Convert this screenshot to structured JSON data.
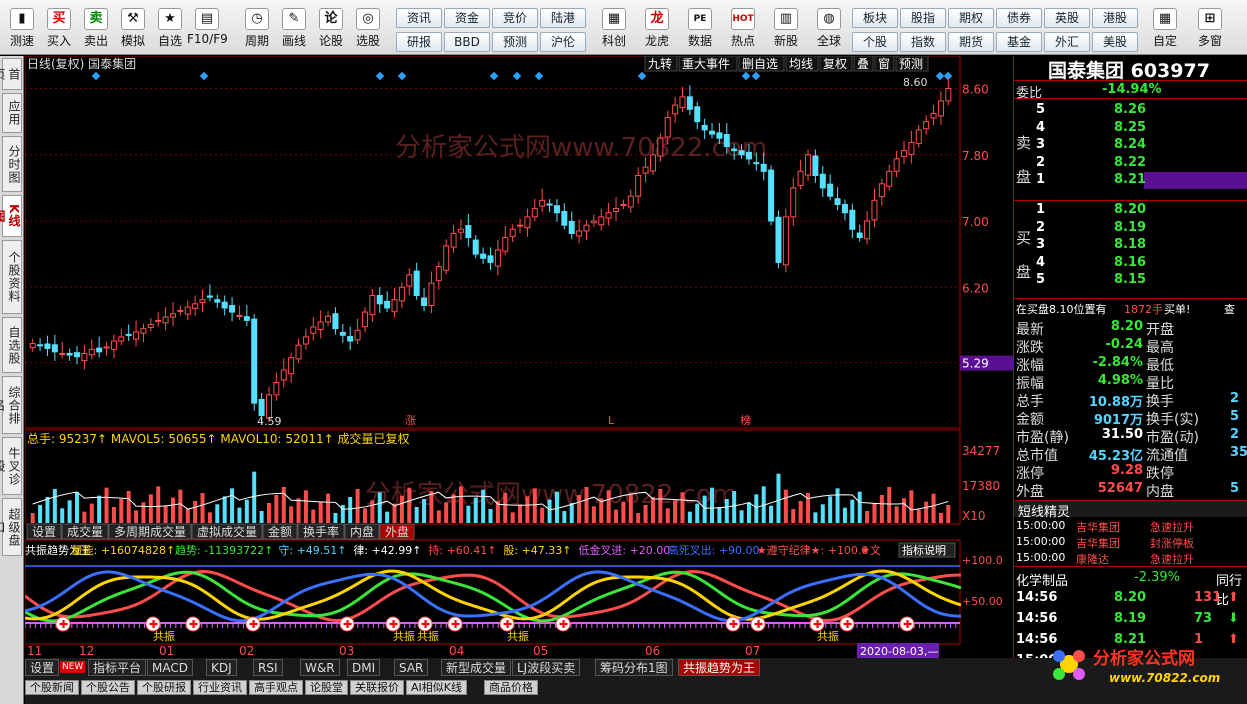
{
  "toolbar": {
    "buttons": [
      {
        "label": "测速",
        "icon": "signal-icon"
      },
      {
        "label": "买入",
        "icon": "buy-icon",
        "glyph": "买"
      },
      {
        "label": "卖出",
        "icon": "sell-icon",
        "glyph": "卖"
      },
      {
        "label": "模拟",
        "icon": "hammer-icon",
        "glyph": "⚒"
      },
      {
        "label": "自选",
        "icon": "star-icon",
        "glyph": "★"
      },
      {
        "label": "F10/F9",
        "icon": "f10-icon",
        "glyph": "▤"
      },
      {
        "label": "周期",
        "icon": "clock-icon",
        "glyph": "◷"
      },
      {
        "label": "画线",
        "icon": "pen-icon",
        "glyph": "✎"
      },
      {
        "label": "论股",
        "icon": "discuss-icon",
        "glyph": "论"
      },
      {
        "label": "选股",
        "icon": "screener-icon",
        "glyph": "◎"
      }
    ],
    "grid": [
      [
        "资讯",
        "资金",
        "竞价",
        "陆港"
      ],
      [
        "研报",
        "BBD",
        "预测",
        "沪伦"
      ]
    ],
    "buttons2": [
      {
        "label": "科创",
        "icon": "kechuang-icon",
        "glyph": "▦"
      },
      {
        "label": "龙虎",
        "icon": "dragon-icon",
        "glyph": "龙"
      },
      {
        "label": "数据",
        "icon": "pe-icon",
        "glyph": "PE"
      },
      {
        "label": "热点",
        "icon": "hot-icon",
        "glyph": "HOT"
      },
      {
        "label": "新股",
        "icon": "newstock-icon",
        "glyph": "▥"
      },
      {
        "label": "全球",
        "icon": "globe-icon",
        "glyph": "◍"
      }
    ],
    "grid2": [
      [
        "板块",
        "股指",
        "期权",
        "债券",
        "英股",
        "港股"
      ],
      [
        "个股",
        "指数",
        "期货",
        "基金",
        "外汇",
        "美股"
      ]
    ],
    "buttons3": [
      {
        "label": "自定",
        "icon": "custom-icon",
        "glyph": "▦"
      },
      {
        "label": "多窗",
        "icon": "multiwindow-icon",
        "glyph": "⊞"
      }
    ]
  },
  "sidetabs": [
    {
      "label": "首页"
    },
    {
      "label": "应用"
    },
    {
      "label": "分时图"
    },
    {
      "label": "K线图",
      "active": true
    },
    {
      "label": "个股资料"
    },
    {
      "label": "自选股"
    },
    {
      "label": "综合排名"
    },
    {
      "label": "牛叉诊股"
    },
    {
      "label": "超级盘口"
    }
  ],
  "chart": {
    "header_left": "日线(复权)  国泰集团",
    "header_buttons": [
      "九转",
      "重大事件",
      "删自选",
      "均线",
      "复权",
      "叠",
      "窗",
      "预测"
    ],
    "price_axis": [
      "8.60",
      "7.80",
      "7.00",
      "6.20",
      "5.29"
    ],
    "price_label_high": "8.60",
    "price_label_low": "4.59",
    "current_price_tag": "5.29",
    "volume_legend": "总手: 95237↑ MAVOL5: 50655↑ MAVOL10: 52011↑ 成交量已复权",
    "volume_axis": [
      "34277",
      "17380",
      "X10"
    ],
    "volume_tabs": [
      "设置",
      "成交量",
      "多周期成交量",
      "虚拟成交量",
      "金额",
      "换手率",
      "内盘",
      "外盘"
    ],
    "indicator_legend": [
      {
        "text": "共振趋势为王",
        "color": "#ffffff"
      },
      {
        "text": "量能: +16074828↑",
        "color": "#ffd400"
      },
      {
        "text": "趋势: -11393722↑",
        "color": "#39e639"
      },
      {
        "text": "守: +49.51↑",
        "color": "#55d5ff"
      },
      {
        "text": "律: +42.99↑",
        "color": "#ffffff"
      },
      {
        "text": "持: +60.41↑",
        "color": "#ff4d4d"
      },
      {
        "text": "股: +47.33↑",
        "color": "#ffd400"
      },
      {
        "text": "低金叉进: +20.00",
        "color": "#e05cff"
      },
      {
        "text": "高死叉出: +90.00",
        "color": "#3a6fff"
      },
      {
        "text": "★遵守纪律★: +100.0",
        "color": "#ff4d4d"
      },
      {
        "text": "★文",
        "color": "#ff4d4d"
      }
    ],
    "indicator_help": "指标说明",
    "indicator_axis": [
      "+100.0",
      "+50.00"
    ],
    "date_axis": [
      "11",
      "12",
      "01",
      "02",
      "03",
      "04",
      "05",
      "06",
      "07"
    ],
    "date_tag": "2020-08-03,—",
    "markers": [
      "涨",
      "L",
      "榜"
    ],
    "watermark_text": "分析家公式网www.70822.com",
    "gongzhen_label": "共振",
    "bottom_tabs": [
      "设置",
      "指标平台",
      "MACD",
      "KDJ",
      "RSI",
      "W&R",
      "DMI",
      "SAR",
      "新型成交量",
      "LJ波段买卖",
      "筹码分布1图",
      "共振趋势为王"
    ],
    "bottom_tabs_active": "共振趋势为王",
    "new_badge": "NEW",
    "news_tabs": [
      "个股新闻",
      "个股公告",
      "个股研报",
      "行业资讯",
      "高手观点",
      "论股堂",
      "关联报价",
      "AI相似K线",
      "商品价格"
    ]
  },
  "chart_data": {
    "type": "candlestick",
    "title": "日线(复权) 国泰集团",
    "ylim": [
      4.5,
      8.8
    ],
    "x_ticks": [
      "11",
      "12",
      "01",
      "02",
      "03",
      "04",
      "05",
      "06",
      "07"
    ],
    "close": [
      5.52,
      5.5,
      5.46,
      5.42,
      5.4,
      5.38,
      5.36,
      5.4,
      5.45,
      5.42,
      5.48,
      5.55,
      5.6,
      5.62,
      5.66,
      5.7,
      5.75,
      5.8,
      5.84,
      5.88,
      5.92,
      5.96,
      6.0,
      6.05,
      6.08,
      6.02,
      5.95,
      5.9,
      5.86,
      5.8,
      4.8,
      4.65,
      4.9,
      5.05,
      5.2,
      5.35,
      5.5,
      5.6,
      5.72,
      5.78,
      5.85,
      5.7,
      5.62,
      5.55,
      5.68,
      5.9,
      6.1,
      6.0,
      5.95,
      6.05,
      6.2,
      6.35,
      6.1,
      5.98,
      6.25,
      6.45,
      6.7,
      6.85,
      6.9,
      6.8,
      6.6,
      6.55,
      6.5,
      6.65,
      6.8,
      6.9,
      6.95,
      7.05,
      7.15,
      7.25,
      7.2,
      7.1,
      6.95,
      6.85,
      6.88,
      6.95,
      7.0,
      7.05,
      7.1,
      7.15,
      7.2,
      7.3,
      7.55,
      7.65,
      7.8,
      8.0,
      8.25,
      8.4,
      8.5,
      8.35,
      8.2,
      8.1,
      8.05,
      8.0,
      7.9,
      7.85,
      7.8,
      7.75,
      7.7,
      7.6,
      7.0,
      6.5,
      7.05,
      7.4,
      7.6,
      7.8,
      7.55,
      7.4,
      7.3,
      7.2,
      7.1,
      6.9,
      6.8,
      7.0,
      7.25,
      7.45,
      7.6,
      7.75,
      7.85,
      7.95,
      8.1,
      8.2,
      8.3,
      8.45,
      8.6
    ],
    "volume_axis_max": 34277,
    "mavol5": 50655,
    "mavol10": 52011,
    "total_volume": 95237
  },
  "panel": {
    "title": "国泰集团 603977",
    "weibi_label": "委比",
    "weibi_value": "-14.94%",
    "sell_label": "卖盘",
    "buy_label": "买盘",
    "sell": [
      {
        "lvl": "5",
        "price": "8.26"
      },
      {
        "lvl": "4",
        "price": "8.25"
      },
      {
        "lvl": "3",
        "price": "8.24"
      },
      {
        "lvl": "2",
        "price": "8.22"
      },
      {
        "lvl": "1",
        "price": "8.21"
      }
    ],
    "buy": [
      {
        "lvl": "1",
        "price": "8.20"
      },
      {
        "lvl": "2",
        "price": "8.19"
      },
      {
        "lvl": "3",
        "price": "8.18"
      },
      {
        "lvl": "4",
        "price": "8.16"
      },
      {
        "lvl": "5",
        "price": "8.15"
      }
    ],
    "notice": {
      "text": "在买盘8.10位置有",
      "qty": "1872手",
      "action": "买单!",
      "link": "查"
    },
    "stats": [
      {
        "l": "最新",
        "v": "8.20",
        "vc": "g",
        "l2": "开盘"
      },
      {
        "l": "涨跌",
        "v": "-0.24",
        "vc": "g",
        "l2": "最高"
      },
      {
        "l": "涨幅",
        "v": "-2.84%",
        "vc": "g",
        "l2": "最低"
      },
      {
        "l": "振幅",
        "v": "4.98%",
        "vc": "g",
        "l2": "量比"
      },
      {
        "l": "总手",
        "v": "10.88万",
        "vc": "c",
        "l2": "换手",
        "v2": "2"
      },
      {
        "l": "金额",
        "v": "9017万",
        "vc": "c",
        "l2": "换手(实)",
        "v2": "5"
      },
      {
        "l": "市盈(静)",
        "v": "31.50",
        "vc": "w",
        "l2": "市盈(动)",
        "v2": "2"
      },
      {
        "l": "总市值",
        "v": "45.23亿",
        "vc": "c",
        "l2": "流通值",
        "v2": "35."
      },
      {
        "l": "涨停",
        "v": "9.28",
        "vc": "r",
        "l2": "跌停"
      },
      {
        "l": "外盘",
        "v": "52647",
        "vc": "r",
        "l2": "内盘",
        "v2": "5"
      }
    ],
    "short_title": "短线精灵",
    "short_rows": [
      {
        "t": "15:00:00",
        "name": "吉华集团",
        "evt": "急速拉升"
      },
      {
        "t": "15:00:00",
        "name": "吉华集团",
        "evt": "封涨停板"
      },
      {
        "t": "15:00:00",
        "name": "康隆达",
        "evt": "急速拉升"
      }
    ],
    "sector": {
      "name": "化学制品",
      "pct": "-2.39%",
      "link": "同行比"
    },
    "ticks": [
      {
        "t": "14:56",
        "p": "8.20",
        "q": "131",
        "dir": "up"
      },
      {
        "t": "14:56",
        "p": "8.19",
        "q": "73",
        "dir": "down"
      },
      {
        "t": "14:56",
        "p": "8.21",
        "q": "1",
        "dir": "up"
      },
      {
        "t": "15:00",
        "p": "",
        "q": "",
        "dir": ""
      }
    ],
    "detail_btn": "细"
  },
  "watermark": {
    "cn": "分析家公式网",
    "url": "www.70822.com"
  }
}
